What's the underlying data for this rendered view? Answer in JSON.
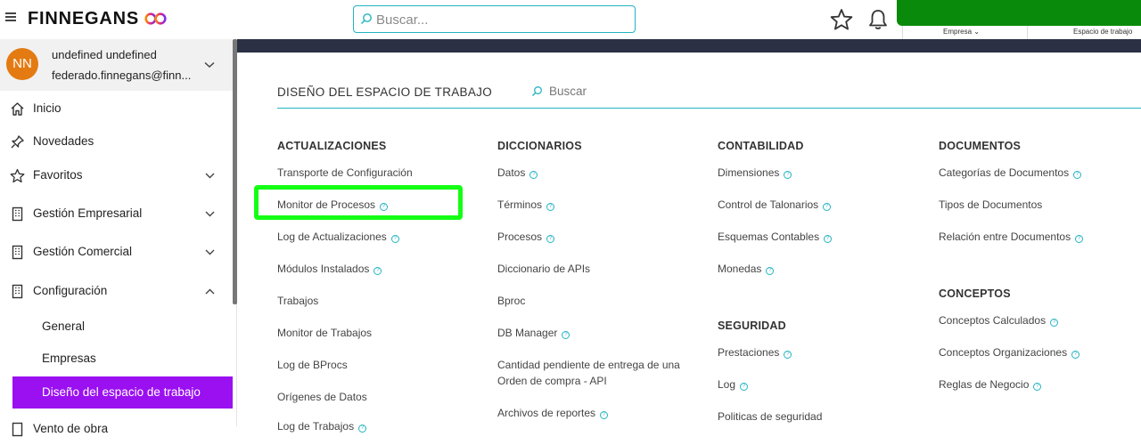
{
  "topbar": {
    "brand": "FINNEGANS",
    "search_placeholder": "Buscar...",
    "empresa_label": "Empresa",
    "workspace_label": "Espacio de trabajo"
  },
  "user": {
    "initials": "NN",
    "name": "undefined undefined",
    "email": "federado.finnegans@finn..."
  },
  "sidebar": {
    "items": [
      {
        "label": "Inicio"
      },
      {
        "label": "Novedades"
      },
      {
        "label": "Favoritos"
      },
      {
        "label": "Gestión Empresarial"
      },
      {
        "label": "Gestión Comercial"
      },
      {
        "label": "Configuración"
      }
    ],
    "subitems": [
      {
        "label": "General"
      },
      {
        "label": "Empresas"
      },
      {
        "label": "Diseño del espacio de trabajo"
      }
    ],
    "partial_item": "Vento de obra"
  },
  "main": {
    "title": "DISEÑO DEL ESPACIO DE TRABAJO",
    "search_label": "Buscar",
    "columns": {
      "actualizaciones": {
        "heading": "ACTUALIZACIONES",
        "links": [
          "Transporte de Configuración",
          "Monitor de Procesos",
          "Log de Actualizaciones",
          "Módulos Instalados",
          "Trabajos",
          "Monitor de Trabajos",
          "Log de BProcs",
          "Orígenes de Datos",
          "Log de Trabajos"
        ]
      },
      "diccionarios": {
        "heading": "DICCIONARIOS",
        "links": [
          "Datos",
          "Términos",
          "Procesos",
          "Diccionario de APIs",
          "Bproc",
          "DB Manager",
          "Cantidad pendiente de entrega de una Orden de compra - API",
          "Archivos de reportes"
        ]
      },
      "contabilidad": {
        "heading": "CONTABILIDAD",
        "links": [
          "Dimensiones",
          "Control de Talonarios",
          "Esquemas Contables",
          "Monedas"
        ]
      },
      "seguridad": {
        "heading": "SEGURIDAD",
        "links": [
          "Prestaciones",
          "Log",
          "Politicas de seguridad"
        ]
      },
      "documentos": {
        "heading": "DOCUMENTOS",
        "links": [
          "Categorías de Documentos",
          "Tipos de Documentos",
          "Relación entre Documentos"
        ]
      },
      "conceptos": {
        "heading": "CONCEPTOS",
        "links": [
          "Conceptos Calculados",
          "Conceptos Organizaciones",
          "Reglas de Negocio"
        ]
      }
    },
    "help_glyph": "?"
  },
  "colors": {
    "accent": "#23b4c2",
    "active_nav": "#9a10f0",
    "avatar": "#e37a12",
    "brand_box": "#0a8a0a",
    "highlight": "#14ff14",
    "header_band": "#2b3045"
  }
}
